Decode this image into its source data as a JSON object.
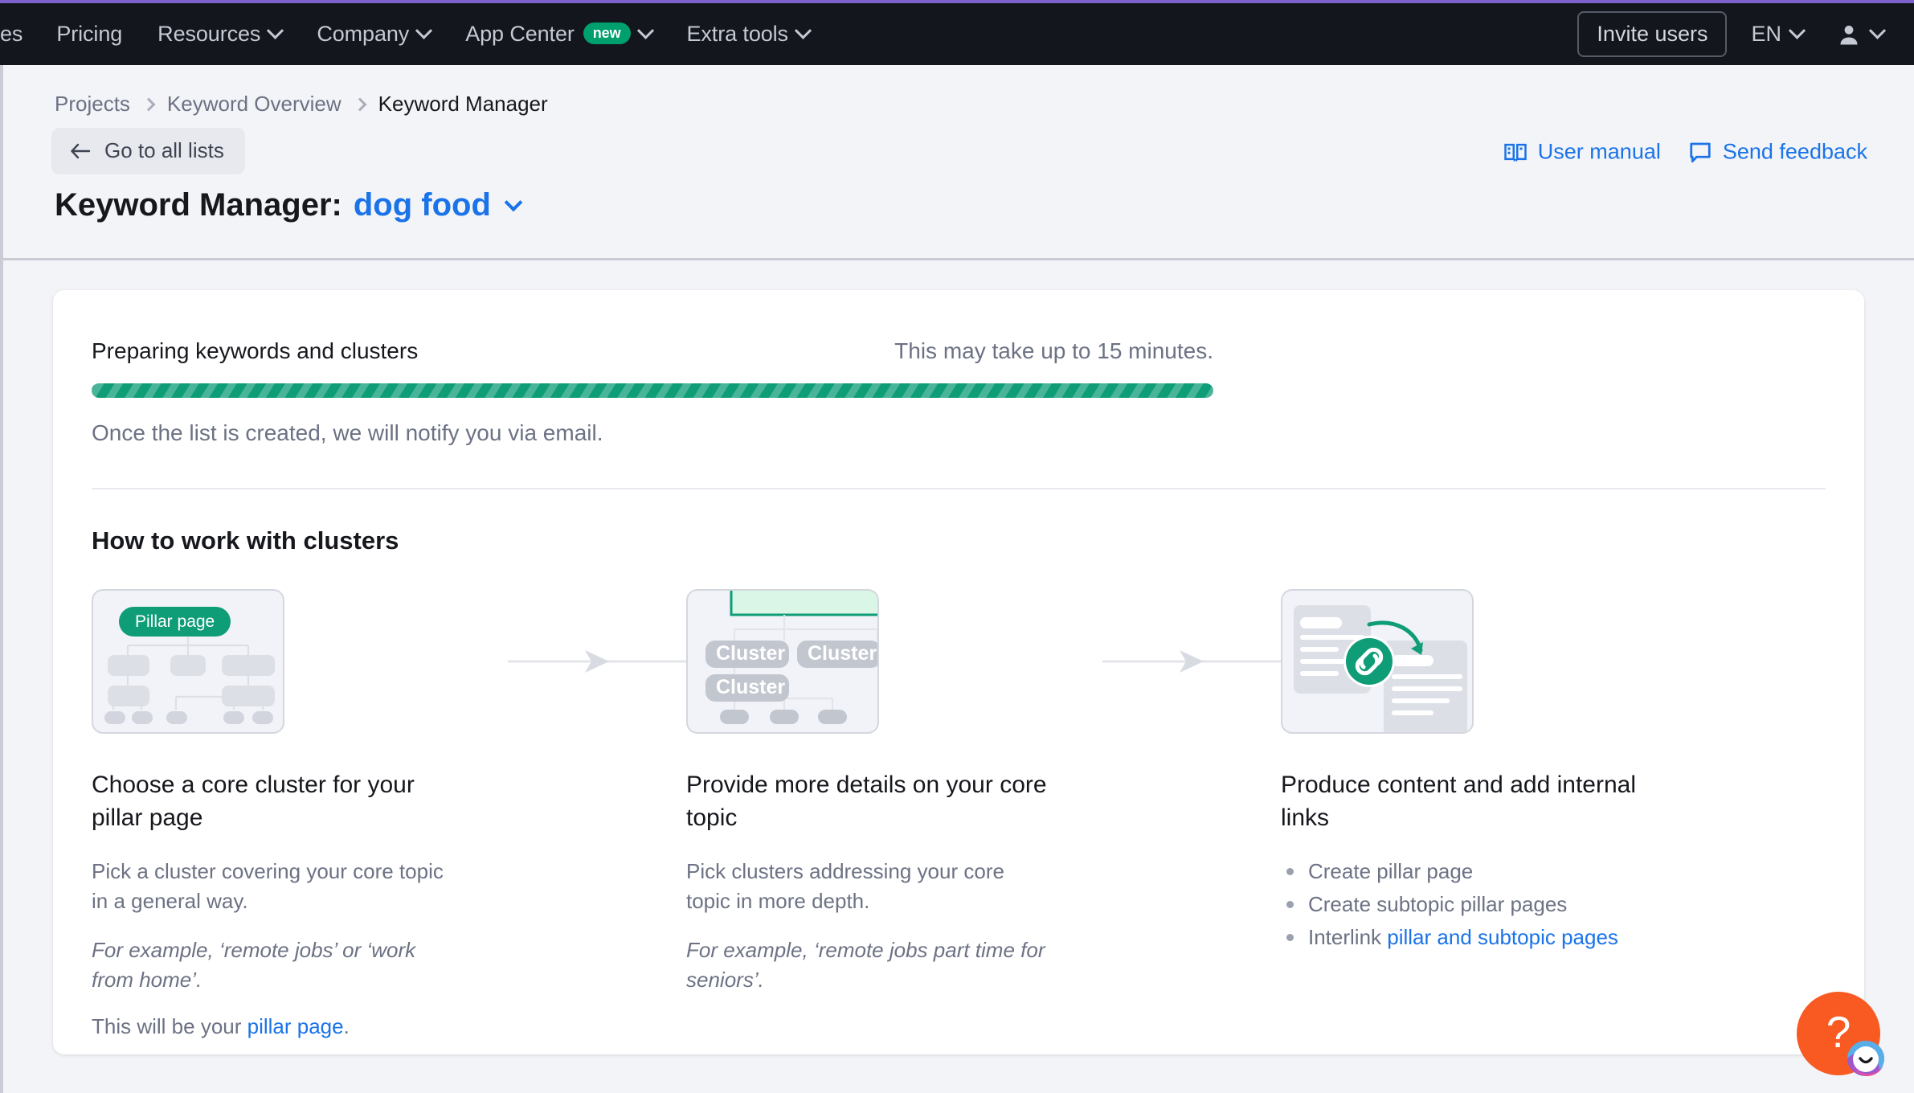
{
  "topbar": {
    "accent_strip_color": "#7b61c9",
    "background": "#13161c",
    "items": [
      {
        "label": "es",
        "has_caret": false,
        "badge": null
      },
      {
        "label": "Pricing",
        "has_caret": false,
        "badge": null
      },
      {
        "label": "Resources",
        "has_caret": true,
        "badge": null
      },
      {
        "label": "Company",
        "has_caret": true,
        "badge": null
      },
      {
        "label": "App Center",
        "has_caret": true,
        "badge": "new"
      },
      {
        "label": "Extra tools",
        "has_caret": true,
        "badge": null
      }
    ],
    "invite_label": "Invite users",
    "language": "EN",
    "badge_color": "#009f6e"
  },
  "header": {
    "breadcrumb": [
      "Projects",
      "Keyword Overview",
      "Keyword Manager"
    ],
    "back_button": "Go to all lists",
    "title_prefix": "Keyword Manager:",
    "title_keyword": "dog food",
    "links": [
      {
        "label": "User manual",
        "icon": "book-icon"
      },
      {
        "label": "Send feedback",
        "icon": "speech-bubble-icon"
      }
    ],
    "link_color": "#1a73e8"
  },
  "progress": {
    "title": "Preparing keywords and clusters",
    "eta": "This may take up to 15 minutes.",
    "note": "Once the list is created, we will notify you via email.",
    "percent": 100,
    "bar_color": "#0f9d77"
  },
  "how_to": {
    "heading": "How to work with clusters",
    "steps": [
      {
        "illustration": "pillar-page-tree-illustration",
        "illustration_badge": "Pillar page",
        "title": "Choose a core cluster for your pillar page",
        "body": "Pick a cluster covering your core topic in a general way.",
        "example": "For example, ‘remote jobs’ or ‘work from home’.",
        "footer_prefix": "This will be your ",
        "footer_link": "pillar page",
        "footer_suffix": "."
      },
      {
        "illustration": "cluster-tree-illustration",
        "illustration_labels": [
          "Cluster",
          "Cluster",
          "Cluster"
        ],
        "title": "Provide more details on your core topic",
        "body": "Pick clusters addressing your core topic in more depth.",
        "example": "For example, ‘remote jobs part time for seniors’."
      },
      {
        "illustration": "internal-links-illustration",
        "title": "Produce content and add internal links",
        "bullets": [
          {
            "text": "Create pillar page"
          },
          {
            "text": "Create subtopic pillar pages"
          },
          {
            "prefix": "Interlink ",
            "link": "pillar and subtopic pages"
          }
        ]
      }
    ]
  },
  "help": {
    "label": "?",
    "color": "#f85a22"
  }
}
